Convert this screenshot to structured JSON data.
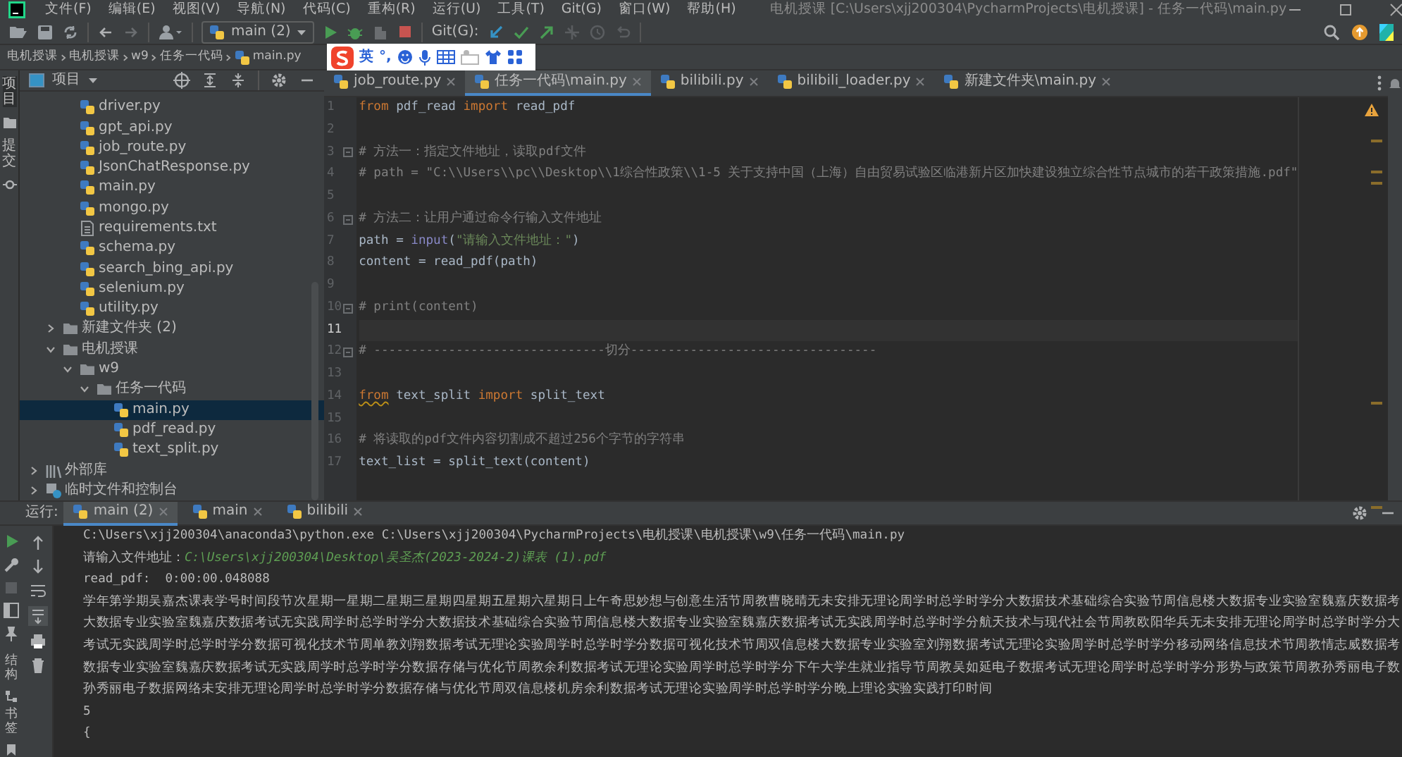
{
  "window": {
    "title": "电机授课 [C:\\Users\\xjj200304\\PycharmProjects\\电机授课] - 任务一代码\\main.py"
  },
  "menu": [
    "文件(F)",
    "编辑(E)",
    "视图(V)",
    "导航(N)",
    "代码(C)",
    "重构(R)",
    "运行(U)",
    "工具(T)",
    "Git(G)",
    "窗口(W)",
    "帮助(H)"
  ],
  "toolbar": {
    "run_config": "main (2)",
    "git_label": "Git(G):"
  },
  "breadcrumb": [
    "电机授课",
    "电机授课",
    "w9",
    "任务一代码",
    "main.py"
  ],
  "ime_bar": {
    "mode": "英",
    "punctuation": "°,"
  },
  "left_strip": {
    "top": [
      "项目",
      "提交"
    ],
    "bottom": [
      "结构",
      "书签"
    ]
  },
  "project_panel": {
    "title": "项目"
  },
  "tree": [
    {
      "kind": "group",
      "children": [
        {
          "kind": "group",
          "children": [
            {
              "kind": "py",
              "label": "driver.py",
              "selected": false
            },
            {
              "kind": "py",
              "label": "gpt_api.py",
              "selected": false
            },
            {
              "kind": "py",
              "label": "job_route.py",
              "selected": false
            },
            {
              "kind": "py",
              "label": "JsonChatResponse.py",
              "selected": false
            },
            {
              "kind": "py",
              "label": "main.py",
              "selected": false
            },
            {
              "kind": "py",
              "label": "mongo.py",
              "selected": false
            },
            {
              "kind": "txt",
              "label": "requirements.txt",
              "selected": false
            },
            {
              "kind": "py",
              "label": "schema.py",
              "selected": false
            },
            {
              "kind": "py",
              "label": "search_bing_api.py",
              "selected": false
            },
            {
              "kind": "py",
              "label": "selenium.py",
              "selected": false
            },
            {
              "kind": "py",
              "label": "utility.py",
              "selected": false
            }
          ]
        },
        {
          "kind": "folder",
          "label": "新建文件夹 (2)",
          "expanded": false,
          "selected": false
        },
        {
          "kind": "folder",
          "label": "电机授课",
          "expanded": true,
          "selected": false,
          "children": [
            {
              "kind": "folder",
              "label": "w9",
              "expanded": true,
              "selected": false,
              "children": [
                {
                  "kind": "folder",
                  "label": "任务一代码",
                  "expanded": true,
                  "selected": false,
                  "children": [
                    {
                      "kind": "py",
                      "label": "main.py",
                      "selected": true
                    },
                    {
                      "kind": "py",
                      "label": "pdf_read.py",
                      "selected": false
                    },
                    {
                      "kind": "py",
                      "label": "text_split.py",
                      "selected": false
                    }
                  ]
                }
              ]
            }
          ]
        }
      ]
    },
    {
      "kind": "library",
      "label": "外部库",
      "expanded": false,
      "selected": false
    },
    {
      "kind": "scratches",
      "label": "临时文件和控制台",
      "expanded": false,
      "selected": false
    }
  ],
  "editor_tabs": [
    {
      "label": "job_route.py",
      "selected": false
    },
    {
      "label": "任务一代码\\main.py",
      "selected": true
    },
    {
      "label": "bilibili.py",
      "selected": false
    },
    {
      "label": "bilibili_loader.py",
      "selected": false
    },
    {
      "label": "新建文件夹\\main.py",
      "selected": false
    }
  ],
  "code": [
    {
      "number": "1",
      "current": false,
      "fold": false,
      "parts": [
        {
          "kind": "kw",
          "text": "from"
        },
        {
          "kind": "id",
          "text": " pdf_read "
        },
        {
          "kind": "kw",
          "text": "import"
        },
        {
          "kind": "id",
          "text": " read_pdf"
        }
      ]
    },
    {
      "number": "2",
      "current": false,
      "fold": false
    },
    {
      "number": "3",
      "current": false,
      "fold": true,
      "parts": [
        {
          "kind": "cm",
          "text": "# 方法一：指定文件地址，读取pdf文件"
        }
      ]
    },
    {
      "number": "4",
      "current": false,
      "fold": false,
      "parts": [
        {
          "kind": "cm",
          "text": "# path = \"C:\\\\Users\\\\pc\\\\Desktop\\\\1综合性政策\\\\1-5 关于支持中国（上海）自由贸易试验区临港新片区加快建设独立综合性节点城市的若干政策措施.pdf\""
        }
      ]
    },
    {
      "number": "5",
      "current": false,
      "fold": false
    },
    {
      "number": "6",
      "current": false,
      "fold": true,
      "parts": [
        {
          "kind": "cm",
          "text": "# 方法二：让用户通过命令行输入文件地址"
        }
      ]
    },
    {
      "number": "7",
      "current": false,
      "fold": false,
      "parts": [
        {
          "kind": "id",
          "text": "path = "
        },
        {
          "kind": "fn",
          "text": "input"
        },
        {
          "kind": "id",
          "text": "("
        },
        {
          "kind": "str",
          "text": "\"请输入文件地址：\""
        },
        {
          "kind": "id",
          "text": ")"
        }
      ]
    },
    {
      "number": "8",
      "current": false,
      "fold": false,
      "parts": [
        {
          "kind": "id",
          "text": "content = read_pdf(path)"
        }
      ]
    },
    {
      "number": "9",
      "current": false,
      "fold": false
    },
    {
      "number": "10",
      "current": false,
      "fold": true,
      "parts": [
        {
          "kind": "cm",
          "text": "# print(content)"
        }
      ]
    },
    {
      "number": "11",
      "current": true,
      "fold": false
    },
    {
      "number": "12",
      "current": false,
      "fold": true,
      "parts": [
        {
          "kind": "cm",
          "text": "# -------------------------------切分---------------------------------"
        }
      ]
    },
    {
      "number": "13",
      "current": false,
      "fold": false
    },
    {
      "number": "14",
      "current": false,
      "fold": false,
      "parts": [
        {
          "kind": "kwwarn",
          "text": "from"
        },
        {
          "kind": "id",
          "text": " text_split "
        },
        {
          "kind": "kw",
          "text": "import"
        },
        {
          "kind": "id",
          "text": " split_text"
        }
      ]
    },
    {
      "number": "15",
      "current": false,
      "fold": false
    },
    {
      "number": "16",
      "current": false,
      "fold": false,
      "parts": [
        {
          "kind": "cm",
          "text": "# 将读取的pdf文件内容切割成不超过256个字节的字符串"
        }
      ]
    },
    {
      "number": "17",
      "current": false,
      "fold": false,
      "parts": [
        {
          "kind": "id",
          "text": "text_list = split_text(content)"
        }
      ]
    }
  ],
  "run_panel": {
    "label": "运行:",
    "tabs": [
      {
        "label": "main (2)",
        "selected": true
      },
      {
        "label": "main",
        "selected": false
      },
      {
        "label": "bilibili",
        "selected": false
      }
    ],
    "output": [
      {
        "text": "C:\\Users\\xjj200304\\anaconda3\\python.exe C:\\Users\\xjj200304\\PycharmProjects\\电机授课\\电机授课\\w9\\任务一代码\\main.py"
      },
      {
        "text": "请输入文件地址：",
        "input": "C:\\Users\\xjj200304\\Desktop\\吴圣杰(2023-2024-2)课表 (1).pdf"
      },
      {
        "text": "read_pdf:  0:00:00.048088"
      },
      {
        "text": "学年第学期吴嘉杰课表学号时间段节次星期一星期二星期三星期四星期五星期六星期日上午奇思妙想与创意生活节周教曹晓晴无未安排无理论周学时总学时学分大数据技术基础综合实验节周信息楼大数据专业实验室魏嘉庆数据考"
      },
      {
        "text": "大数据专业实验室魏嘉庆数据考试无实践周学时总学时学分大数据技术基础综合实验节周信息楼大数据专业实验室魏嘉庆数据考试无实践周学时总学时学分航天技术与现代社会节周教欧阳华兵无未安排无理论周学时总学时学分大"
      },
      {
        "text": "考试无实践周学时总学时学分数据可视化技术节周单教刘翔数据考试无理论实验周学时总学时学分数据可视化技术节周双信息楼大数据专业实验室刘翔数据考试无理论实验周学时总学时学分移动网络信息技术节周教情志威数据考"
      },
      {
        "text": "数据专业实验室魏嘉庆数据考试无实践周学时总学时学分数据存储与优化节周教余利数据考试无理论实验周学时总学时学分下午大学生就业指导节周教吴如延电子数据考试无理论周学时总学时学分形势与政策节周教孙秀丽电子数"
      },
      {
        "text": "孙秀丽电子数据网络未安排无理论周学时总学时学分数据存储与优化节周双信息楼机房余利数据考试无理论实验周学时总学时学分晚上理论实验实践打印时间"
      },
      {
        "text": "5"
      },
      {
        "text": "{"
      }
    ]
  }
}
